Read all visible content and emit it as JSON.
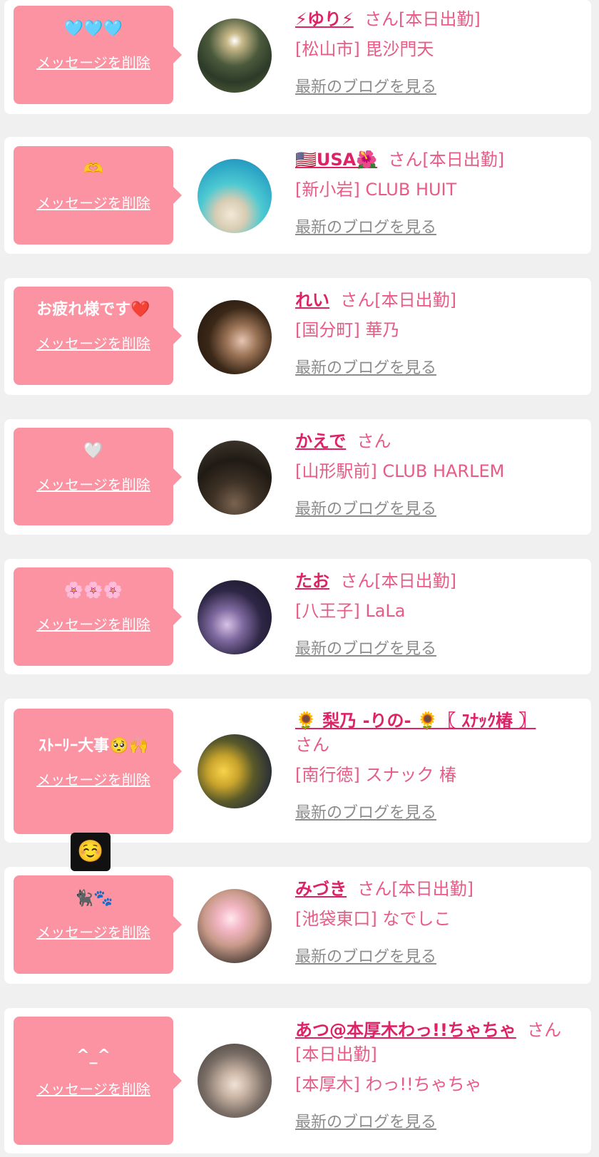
{
  "delete_label": "メッセージを削除",
  "blog_label": "最新のブログを見る",
  "san_label": "さん",
  "colors": {
    "page_bg": "#f0f0f0",
    "bubble_bg": "#fb93a3",
    "name": "#dd2266",
    "blog_link": "#8c8c8c"
  },
  "reaction": "☺️",
  "cards": [
    {
      "message": "🩵🩵🩵",
      "name": "⚡ゆり⚡",
      "status": "[本日出勤]",
      "shop": "[松山市] 毘沙門天",
      "avatar": "night-trees-photo"
    },
    {
      "message": "🫶",
      "name": "🇺🇸USA🌺",
      "status": "[本日出勤]",
      "shop": "[新小岩] CLUB HUIT",
      "avatar": "beach-photo"
    },
    {
      "message": "お疲れ様です❤️",
      "name": "れい",
      "status": "[本日出勤]",
      "shop": "[国分町] 華乃",
      "avatar": "portrait-photo"
    },
    {
      "message": "🤍",
      "name": "かえで",
      "status": "",
      "shop": "[山形駅前] CLUB HARLEM",
      "avatar": "dark-room-photo"
    },
    {
      "message": "🌸🌸🌸",
      "name": "たお",
      "status": "[本日出勤]",
      "shop": "[八王子] LaLa",
      "avatar": "purple-portrait-photo"
    },
    {
      "message": "ｽﾄｰﾘｰ大事🥺🙌",
      "name": "🌻 梨乃 -りの- 🌻〖 ｽﾅｯｸ椿 〗",
      "status": "",
      "shop": "[南行徳] スナック 椿",
      "avatar": "sunflower-photo"
    },
    {
      "message": "🐈‍⬛🐾",
      "name": "みづき",
      "status": "[本日出勤]",
      "shop": "[池袋東口] なでしこ",
      "avatar": "selfie-photo"
    },
    {
      "message": "^_^",
      "name": "あつ@本厚木わっ!!ちゃちゃ",
      "status": "[本日出勤]",
      "shop": "[本厚木] わっ!!ちゃちゃ",
      "avatar": "hat-selfie-photo"
    }
  ]
}
